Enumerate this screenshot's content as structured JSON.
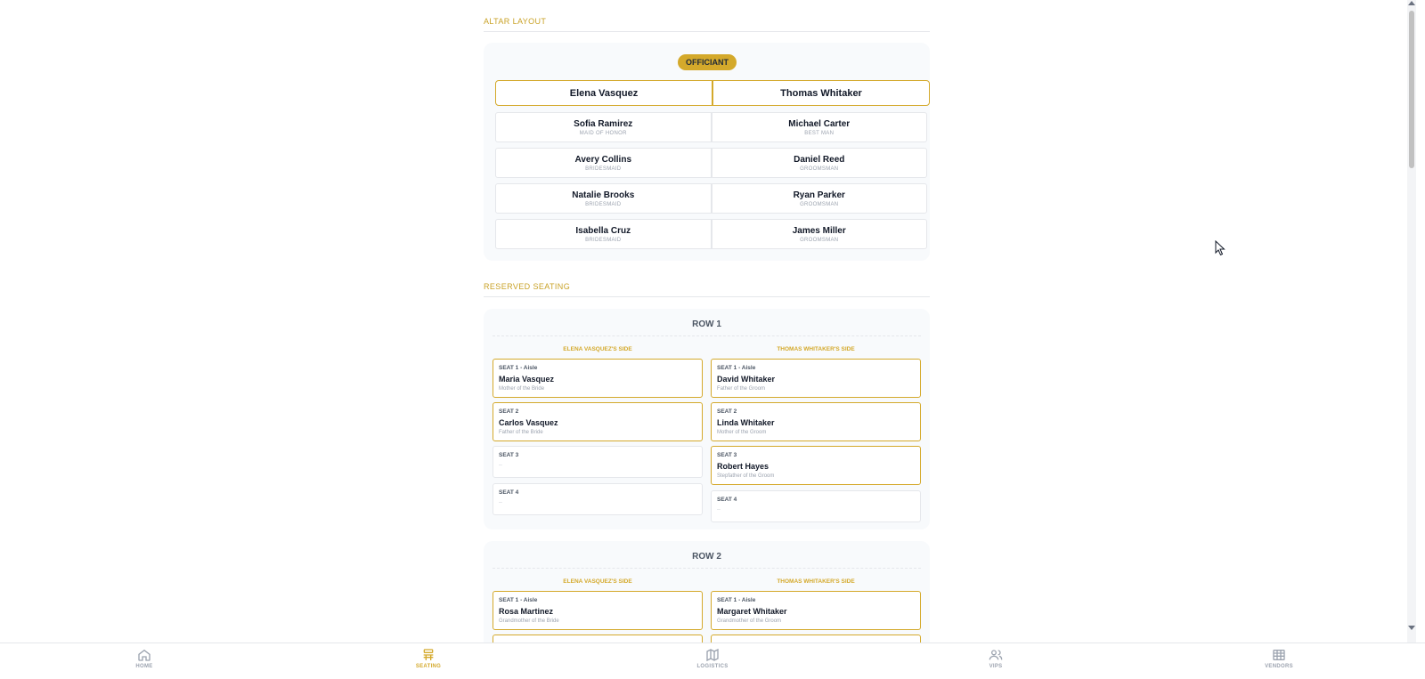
{
  "altar": {
    "section_title": "ALTAR LAYOUT",
    "officiant_label": "OFFICIANT",
    "bride": "Elena Vasquez",
    "groom": "Thomas Whitaker",
    "party": [
      {
        "left": {
          "name": "Sofia Ramirez",
          "role": "MAID OF HONOR"
        },
        "right": {
          "name": "Michael Carter",
          "role": "BEST MAN"
        }
      },
      {
        "left": {
          "name": "Avery Collins",
          "role": "BRIDESMAID"
        },
        "right": {
          "name": "Daniel Reed",
          "role": "GROOMSMAN"
        }
      },
      {
        "left": {
          "name": "Natalie Brooks",
          "role": "BRIDESMAID"
        },
        "right": {
          "name": "Ryan Parker",
          "role": "GROOMSMAN"
        }
      },
      {
        "left": {
          "name": "Isabella Cruz",
          "role": "BRIDESMAID"
        },
        "right": {
          "name": "James Miller",
          "role": "GROOMSMAN"
        }
      }
    ]
  },
  "reserved": {
    "section_title": "RESERVED SEATING",
    "left_side_title": "ELENA VASQUEZ'S SIDE",
    "right_side_title": "THOMAS WHITAKER'S SIDE",
    "empty_placeholder": "–",
    "rows": [
      {
        "title": "ROW 1",
        "left": [
          {
            "label": "SEAT 1 - Aisle",
            "name": "Maria Vasquez",
            "relation": "Mother of the Bride"
          },
          {
            "label": "SEAT 2",
            "name": "Carlos Vasquez",
            "relation": "Father of the Bride"
          },
          {
            "label": "SEAT 3"
          },
          {
            "label": "SEAT 4"
          }
        ],
        "right": [
          {
            "label": "SEAT 1 - Aisle",
            "name": "David Whitaker",
            "relation": "Father of the Groom"
          },
          {
            "label": "SEAT 2",
            "name": "Linda Whitaker",
            "relation": "Mother of the Groom"
          },
          {
            "label": "SEAT 3",
            "name": "Robert Hayes",
            "relation": "Stepfather of the Groom"
          },
          {
            "label": "SEAT 4"
          }
        ]
      },
      {
        "title": "ROW 2",
        "left": [
          {
            "label": "SEAT 1 - Aisle",
            "name": "Rosa Martinez",
            "relation": "Grandmother of the Bride"
          }
        ],
        "right": [
          {
            "label": "SEAT 1 - Aisle",
            "name": "Margaret Whitaker",
            "relation": "Grandmother of the Groom"
          }
        ]
      }
    ]
  },
  "nav": {
    "items": [
      {
        "label": "HOME",
        "icon": "home-icon"
      },
      {
        "label": "SEATING",
        "icon": "seating-icon"
      },
      {
        "label": "LOGISTICS",
        "icon": "map-icon"
      },
      {
        "label": "VIPS",
        "icon": "users-icon"
      },
      {
        "label": "VENDORS",
        "icon": "store-icon"
      }
    ],
    "active_color": "#d4a92b",
    "inactive_color": "#9ca3af"
  },
  "colors": {
    "accent": "#d4a92b",
    "border": "#e5e7eb",
    "panel": "#f8fafc"
  }
}
